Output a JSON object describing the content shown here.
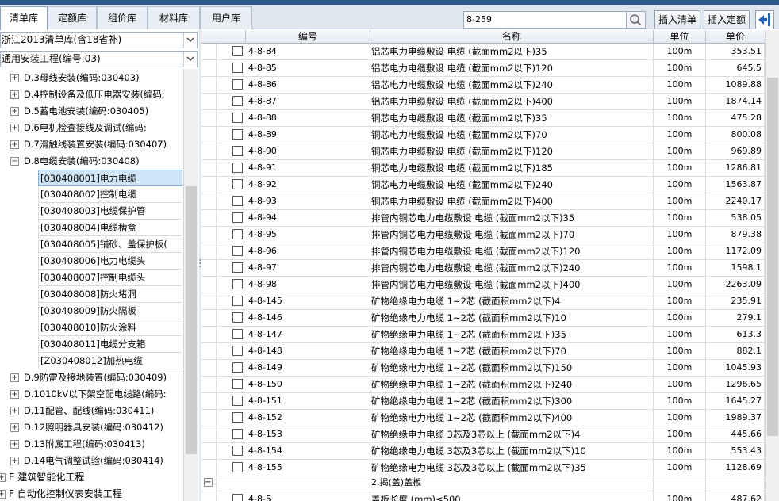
{
  "tabs": [
    "清单库",
    "定额库",
    "组价库",
    "材料库",
    "用户库"
  ],
  "search": {
    "value": "8-259"
  },
  "buttons": {
    "insert_list": "插入清单",
    "insert_quota": "插入定额"
  },
  "left": {
    "combo1": "浙江2013清单库(含18省补)",
    "combo2": "通用安装工程(编号:03)",
    "tree": [
      {
        "exp": "+",
        "label": "D.3母线安装(编码:030403)"
      },
      {
        "exp": "+",
        "label": "D.4控制设备及低压电器安装(编码:"
      },
      {
        "exp": "+",
        "label": "D.5蓄电池安装(编码:030405)"
      },
      {
        "exp": "+",
        "label": "D.6电机检查接线及调试(编码:"
      },
      {
        "exp": "+",
        "label": "D.7滑触线装置安装(编码:030407)"
      },
      {
        "exp": "−",
        "label": "D.8电缆安装(编码:030408)"
      }
    ],
    "leaves": [
      "[030408001]电力电缆",
      "[030408002]控制电缆",
      "[030408003]电缆保护管",
      "[030408004]电缆槽盒",
      "[030408005]铺砂、盖保护板(",
      "[030408006]电力电缆头",
      "[030408007]控制电缆头",
      "[030408008]防火堵洞",
      "[030408009]防火隔板",
      "[030408010]防火涂料",
      "[030408011]电缆分支箱",
      "[Z030408012]加热电缆"
    ],
    "tree_after": [
      {
        "exp": "+",
        "label": "D.9防雷及接地装置(编码:030409)"
      },
      {
        "exp": "+",
        "label": "D.1010kV以下架空配电线路(编码:"
      },
      {
        "exp": "+",
        "label": "D.11配管、配线(编码:030411)"
      },
      {
        "exp": "+",
        "label": "D.12照明器具安装(编码:030412)"
      },
      {
        "exp": "+",
        "label": "D.13附属工程(编码:030413)"
      },
      {
        "exp": "+",
        "label": "D.14电气调整试验(编码:030414)"
      }
    ],
    "tree_root": [
      {
        "exp": "+",
        "label": "E 建筑智能化工程"
      },
      {
        "exp": "+",
        "label": "F 自动化控制仪表安装工程"
      }
    ]
  },
  "grid": {
    "headers": {
      "code": "编号",
      "name": "名称",
      "unit": "单位",
      "price": "单价"
    },
    "rows": [
      {
        "code": "4-8-84",
        "name": "铝芯电力电缆敷设 电缆 (截面mm2以下)35",
        "unit": "100m",
        "price": "353.51"
      },
      {
        "code": "4-8-85",
        "name": "铝芯电力电缆敷设 电缆 (截面mm2以下)120",
        "unit": "100m",
        "price": "645.5"
      },
      {
        "code": "4-8-86",
        "name": "铝芯电力电缆敷设 电缆 (截面mm2以下)240",
        "unit": "100m",
        "price": "1089.88"
      },
      {
        "code": "4-8-87",
        "name": "铝芯电力电缆敷设 电缆 (截面mm2以下)400",
        "unit": "100m",
        "price": "1874.14"
      },
      {
        "code": "4-8-88",
        "name": "铜芯电力电缆敷设 电缆 (截面mm2以下)35",
        "unit": "100m",
        "price": "475.28"
      },
      {
        "code": "4-8-89",
        "name": "铜芯电力电缆敷设 电缆 (截面mm2以下)70",
        "unit": "100m",
        "price": "800.08"
      },
      {
        "code": "4-8-90",
        "name": "铜芯电力电缆敷设 电缆 (截面mm2以下)120",
        "unit": "100m",
        "price": "969.89"
      },
      {
        "code": "4-8-91",
        "name": "铜芯电力电缆敷设 电缆 (截面mm2以下)185",
        "unit": "100m",
        "price": "1286.81"
      },
      {
        "code": "4-8-92",
        "name": "铜芯电力电缆敷设 电缆 (截面mm2以下)240",
        "unit": "100m",
        "price": "1563.87"
      },
      {
        "code": "4-8-93",
        "name": "铜芯电力电缆敷设 电缆 (截面mm2以下)400",
        "unit": "100m",
        "price": "2240.17"
      },
      {
        "code": "4-8-94",
        "name": "排管内铜芯电力电缆敷设 电缆 (截面mm2以下)35",
        "unit": "100m",
        "price": "538.05"
      },
      {
        "code": "4-8-95",
        "name": "排管内铜芯电力电缆敷设 电缆 (截面mm2以下)70",
        "unit": "100m",
        "price": "879.38"
      },
      {
        "code": "4-8-96",
        "name": "排管内铜芯电力电缆敷设 电缆 (截面mm2以下)120",
        "unit": "100m",
        "price": "1172.09"
      },
      {
        "code": "4-8-97",
        "name": "排管内铜芯电力电缆敷设 电缆 (截面mm2以下)240",
        "unit": "100m",
        "price": "1598.1"
      },
      {
        "code": "4-8-98",
        "name": "排管内铜芯电力电缆敷设 电缆 (截面mm2以下)400",
        "unit": "100m",
        "price": "2263.09"
      },
      {
        "code": "4-8-145",
        "name": "矿物绝缘电力电缆 1~2芯 (截面积mm2以下)4",
        "unit": "100m",
        "price": "235.91"
      },
      {
        "code": "4-8-146",
        "name": "矿物绝缘电力电缆 1~2芯 (截面积mm2以下)10",
        "unit": "100m",
        "price": "279.1"
      },
      {
        "code": "4-8-147",
        "name": "矿物绝缘电力电缆 1~2芯 (截面积mm2以下)35",
        "unit": "100m",
        "price": "613.3"
      },
      {
        "code": "4-8-148",
        "name": "矿物绝缘电力电缆 1~2芯 (截面积mm2以下)70",
        "unit": "100m",
        "price": "882.1"
      },
      {
        "code": "4-8-149",
        "name": "矿物绝缘电力电缆 1~2芯 (截面积mm2以下)150",
        "unit": "100m",
        "price": "1045.93"
      },
      {
        "code": "4-8-150",
        "name": "矿物绝缘电力电缆 1~2芯 (截面积mm2以下)240",
        "unit": "100m",
        "price": "1296.65"
      },
      {
        "code": "4-8-151",
        "name": "矿物绝缘电力电缆 1~2芯 (截面积mm2以下)300",
        "unit": "100m",
        "price": "1645.27"
      },
      {
        "code": "4-8-152",
        "name": "矿物绝缘电力电缆 1~2芯 (截面积mm2以下)400",
        "unit": "100m",
        "price": "1989.37"
      },
      {
        "code": "4-8-153",
        "name": "矿物绝缘电力电缆 3芯及3芯以上 (截面mm2以下)4",
        "unit": "100m",
        "price": "445.66"
      },
      {
        "code": "4-8-154",
        "name": "矿物绝缘电力电缆 3芯及3芯以上 (截面mm2以下)10",
        "unit": "100m",
        "price": "553.43"
      },
      {
        "code": "4-8-155",
        "name": "矿物绝缘电力电缆 3芯及3芯以上 (截面mm2以下)35",
        "unit": "100m",
        "price": "1128.69"
      }
    ],
    "group": {
      "exp": "−",
      "label": "2.揭(盖)盖板"
    },
    "last_row": {
      "code": "4-8-5",
      "name": "盖板长度 (mm)≤500",
      "unit": "100m",
      "price": "487.62"
    }
  }
}
